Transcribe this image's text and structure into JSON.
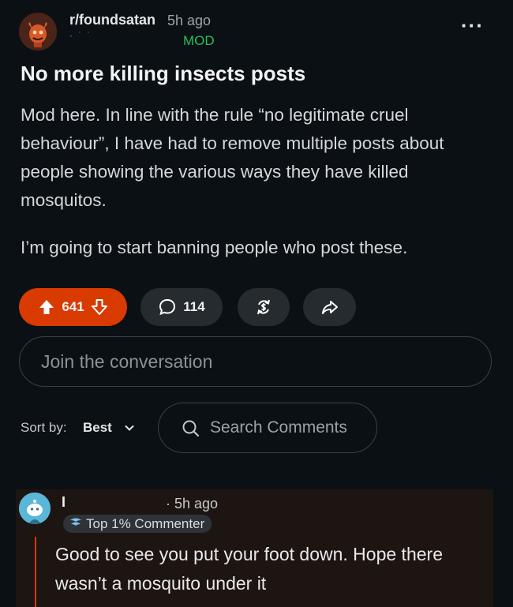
{
  "post": {
    "subreddit": "r/foundsatan",
    "time_ago": "5h ago",
    "author_flair_dots": "· ˙ ˙",
    "mod_badge": "MOD",
    "more_label": "···",
    "title": "No more killing insects posts",
    "body": [
      "Mod here. In line with the rule “no legitimate cruel behaviour”, I have had to remove multiple posts about people showing the various ways they have killed mosquitos.",
      "I’m going to start banning people who post these."
    ]
  },
  "actions": {
    "upvotes": "641",
    "comments": "114"
  },
  "join": {
    "placeholder": "Join the conversation"
  },
  "sort": {
    "label": "Sort by:",
    "value": "Best"
  },
  "search": {
    "placeholder": "Search Comments"
  },
  "comment": {
    "username": "I",
    "time_ago": "· 5h ago",
    "badge": "Top 1% Commenter",
    "text": "Good to see you put your foot down. Hope there wasn’t a mosquito under it"
  },
  "colors": {
    "background": "#0b1015",
    "upvote_pill": "#d93a00",
    "mod_green": "#2fbd5a",
    "pill_gray": "#262b30",
    "comment_bg": "#1d1512"
  },
  "icons": [
    "subreddit-avatar-icon",
    "upvote-icon",
    "downvote-icon",
    "comment-icon",
    "award-icon",
    "share-icon",
    "chevron-down-icon",
    "search-icon",
    "user-avatar-icon",
    "top-commenter-icon"
  ]
}
